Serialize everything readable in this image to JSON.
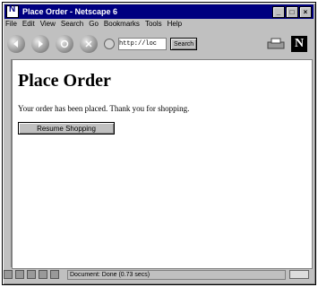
{
  "window": {
    "title": "Place Order - Netscape 6"
  },
  "window_controls": [
    "_",
    "□",
    "×"
  ],
  "menu": [
    "File",
    "Edit",
    "View",
    "Search",
    "Go",
    "Bookmarks",
    "Tools",
    "Help"
  ],
  "toolbar": {
    "address_value": "http://loc",
    "search_label": "Search"
  },
  "content": {
    "heading": "Place Order",
    "message": "Your order has been placed. Thank you for shopping.",
    "resume_button": "Resume Shopping"
  },
  "status": {
    "text": "Document: Done (0.73 secs)"
  }
}
